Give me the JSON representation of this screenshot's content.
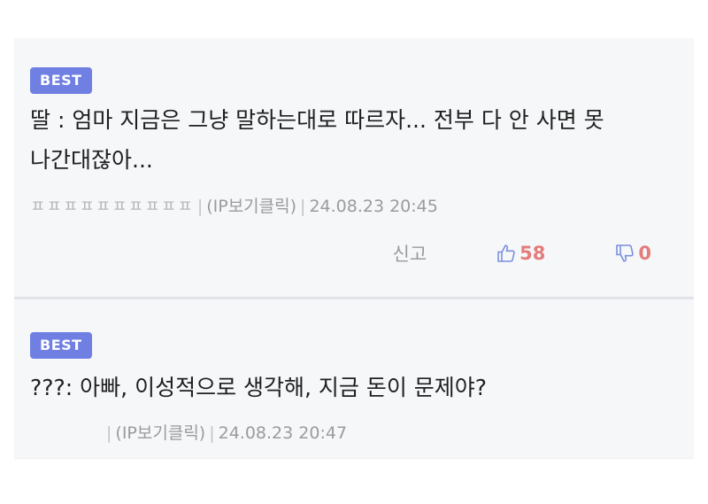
{
  "comments": [
    {
      "badge": "BEST",
      "text": "딸 : 엄마 지금은 그냥 말하는대로 따르자... 전부 다 안 사면 못\n나간대잖아...",
      "nickname": "ㅍㅍㅍㅍㅍㅍㅍㅍㅍㅍ",
      "separator": "|",
      "ip_label": "(IP보기클릭)",
      "timestamp": "24.08.23 20:45",
      "report_label": "신고",
      "likes": "58",
      "dislikes": "0"
    },
    {
      "badge": "BEST",
      "text": "???: 아빠, 이성적으로 생각해, 지금 돈이 문제야?",
      "nickname": "",
      "separator": "|",
      "ip_label": "(IP보기클릭)",
      "timestamp": "24.08.23 20:47"
    }
  ],
  "icons": {
    "like": "thumbs-up-icon",
    "dislike": "thumbs-down-icon"
  },
  "colors": {
    "badge_bg": "#6f7fe2",
    "card_bg": "#f6f7f9",
    "icon_blue": "#7b8fe0",
    "vote_red": "#e47c7c"
  }
}
